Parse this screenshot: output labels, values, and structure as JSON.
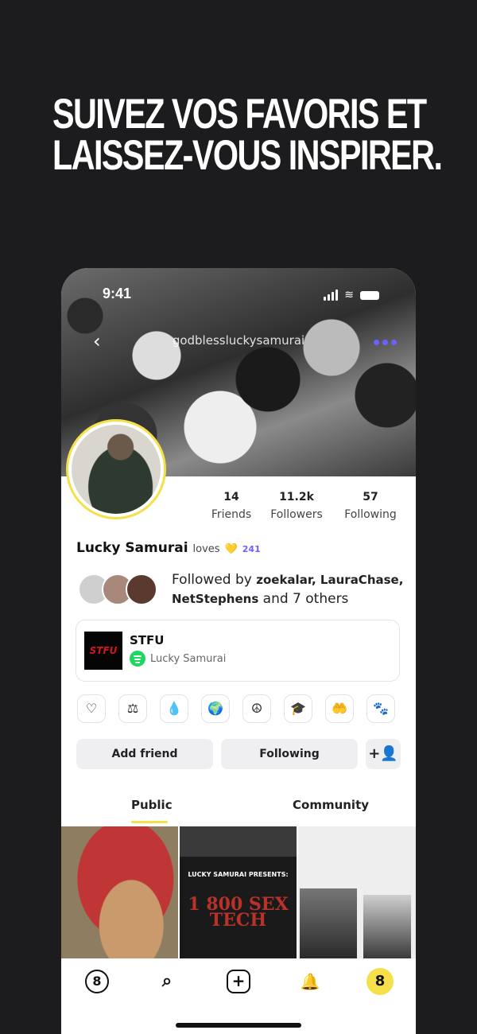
{
  "headline": {
    "line1": "SUIVEZ VOS FAVORIS ET",
    "line2": "LAISSEZ-VOUS INSPIRER."
  },
  "status_bar": {
    "time": "9:41"
  },
  "profile": {
    "back_icon": "‹",
    "handle": "godblessluckysamurai",
    "name": "Lucky Samurai",
    "loves_label": "loves",
    "loves_heart": "💛",
    "loves_count": "241",
    "stats": [
      {
        "value": "14",
        "label": "Friends"
      },
      {
        "value": "11.2k",
        "label": "Followers"
      },
      {
        "value": "57",
        "label": "Following"
      }
    ],
    "followed_by": {
      "prefix": "Followed by",
      "names": "zoekalar, LauraChase,",
      "names2": "NetStephens",
      "suffix": "and 7 others"
    },
    "track": {
      "art_text": "STFU",
      "title": "STFU",
      "artist": "Lucky Samurai",
      "service_icon": "spotify-icon"
    },
    "badges": [
      {
        "name": "heartbeat-icon",
        "glyph": "♡"
      },
      {
        "name": "scales-icon",
        "glyph": "⚖"
      },
      {
        "name": "drop-icon",
        "glyph": "💧"
      },
      {
        "name": "globe-icon",
        "glyph": "🌍"
      },
      {
        "name": "peace-icon",
        "glyph": "☮"
      },
      {
        "name": "graduation-cap-icon",
        "glyph": "🎓"
      },
      {
        "name": "charity-icon",
        "glyph": "🤲"
      },
      {
        "name": "paw-icon",
        "glyph": "🐾"
      }
    ],
    "actions": {
      "add_friend": "Add friend",
      "following": "Following",
      "add_person_icon": "+👤"
    },
    "tabs": [
      "Public",
      "Community"
    ]
  },
  "grid": {
    "post2_presents": "LUCKY SAMURAI PRESENTS:",
    "post2_title": "1 800 SEX TECH"
  },
  "bottom_nav": {
    "home": "8",
    "search": "⌕",
    "add": "+",
    "bell": "🔔",
    "profile": "8"
  },
  "colors": {
    "background": "#1c1c1e",
    "accent_yellow": "#f5e04a",
    "accent_purple": "#6b63ff",
    "spotify_green": "#1ed760"
  }
}
